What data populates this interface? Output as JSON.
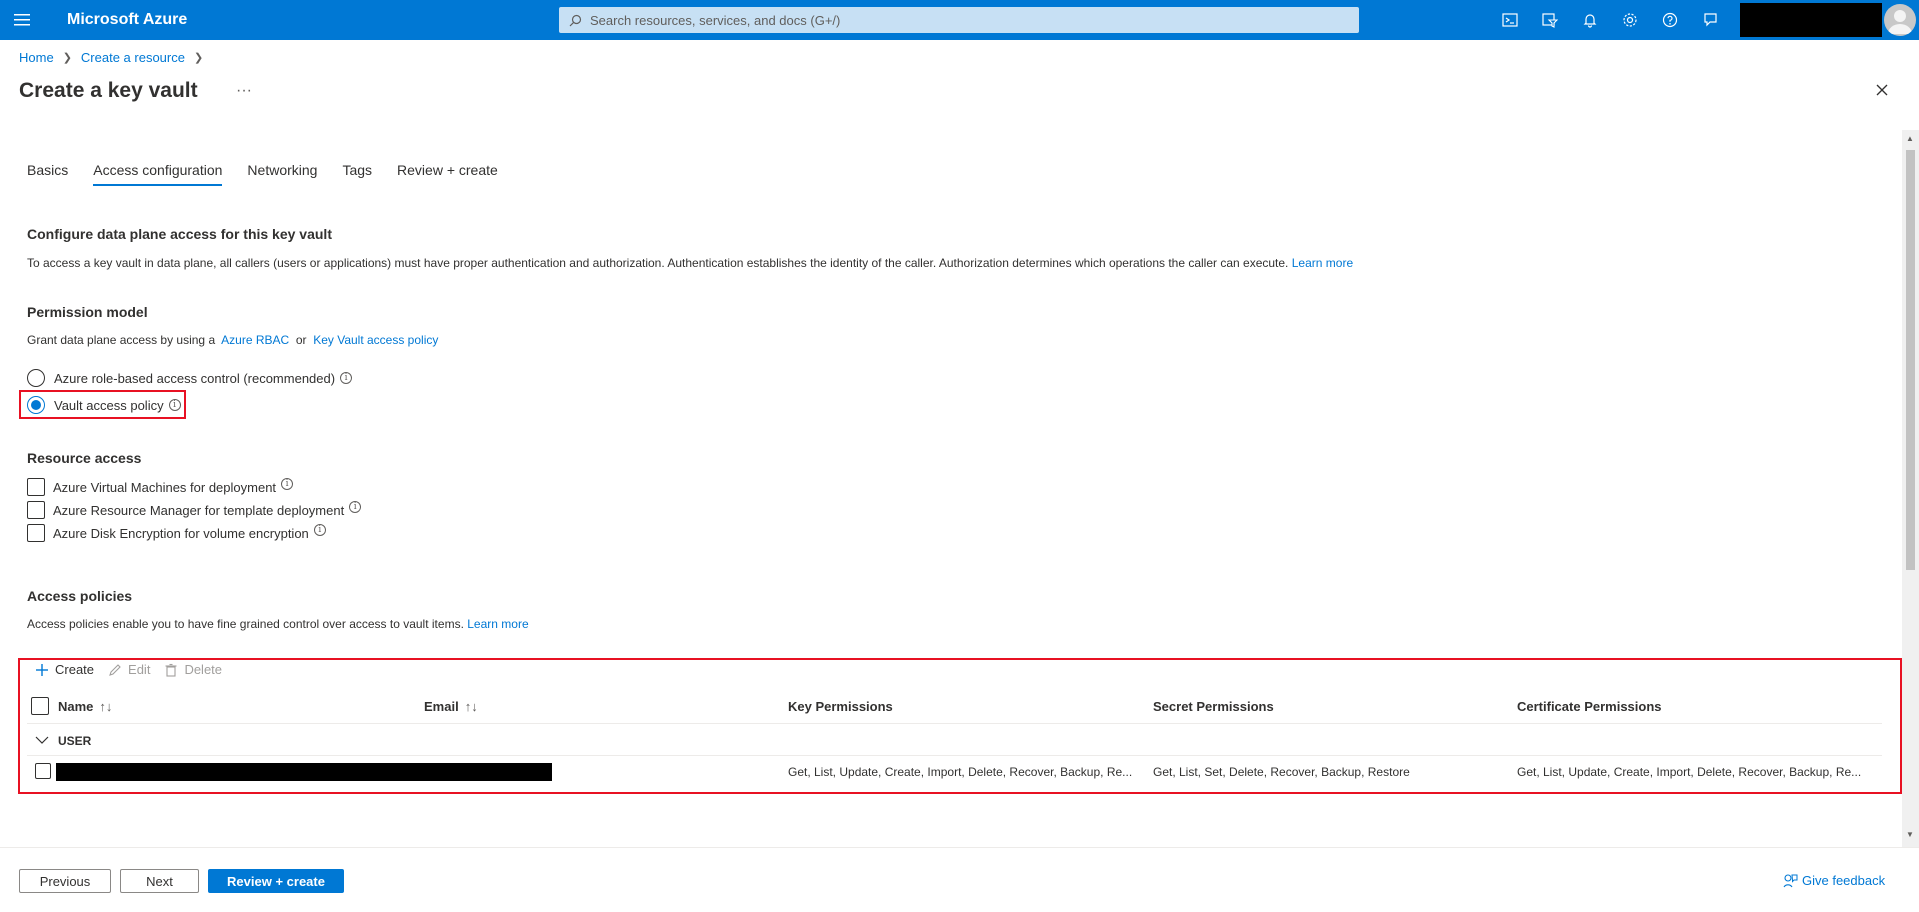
{
  "topbar": {
    "brand": "Microsoft Azure",
    "search_placeholder": "Search resources, services, and docs (G+/)",
    "icons": [
      "cloud-shell-icon",
      "directory-filter-icon",
      "notifications-icon",
      "settings-icon",
      "help-icon",
      "feedback-icon"
    ]
  },
  "breadcrumb": {
    "home": "Home",
    "create_resource": "Create a resource"
  },
  "page": {
    "title": "Create a key vault",
    "more": "···"
  },
  "tabs": [
    "Basics",
    "Access configuration",
    "Networking",
    "Tags",
    "Review + create"
  ],
  "data_plane": {
    "heading": "Configure data plane access for this key vault",
    "description": "To access a key vault in data plane, all callers (users or applications) must have proper authentication and authorization. Authentication establishes the identity of the caller. Authorization determines which operations the caller can execute.",
    "learn_more": "Learn more"
  },
  "permission_model": {
    "heading": "Permission model",
    "intro": "Grant data plane access by using a",
    "rbac_link": "Azure RBAC",
    "or": "or",
    "policy_link": "Key Vault access policy",
    "options": [
      {
        "label": "Azure role-based access control (recommended)",
        "checked": false
      },
      {
        "label": "Vault access policy",
        "checked": true
      }
    ]
  },
  "resource_access": {
    "heading": "Resource access",
    "options": [
      {
        "label": "Azure Virtual Machines for deployment",
        "checked": false
      },
      {
        "label": "Azure Resource Manager for template deployment",
        "checked": false
      },
      {
        "label": "Azure Disk Encryption for volume encryption",
        "checked": false
      }
    ]
  },
  "access_policies": {
    "heading": "Access policies",
    "description": "Access policies enable you to have fine grained control over access to vault items.",
    "learn_more": "Learn more",
    "commands": {
      "create": "Create",
      "edit": "Edit",
      "delete": "Delete"
    },
    "columns": {
      "name": "Name",
      "email": "Email",
      "key": "Key Permissions",
      "secret": "Secret Permissions",
      "certificate": "Certificate Permissions"
    },
    "group": "USER",
    "row": {
      "key": "Get, List, Update, Create, Import, Delete, Recover, Backup, Re...",
      "secret": "Get, List, Set, Delete, Recover, Backup, Restore",
      "certificate": "Get, List, Update, Create, Import, Delete, Recover, Backup, Re..."
    }
  },
  "footer": {
    "previous": "Previous",
    "next": "Next",
    "review_create": "Review + create",
    "feedback": "Give feedback"
  }
}
